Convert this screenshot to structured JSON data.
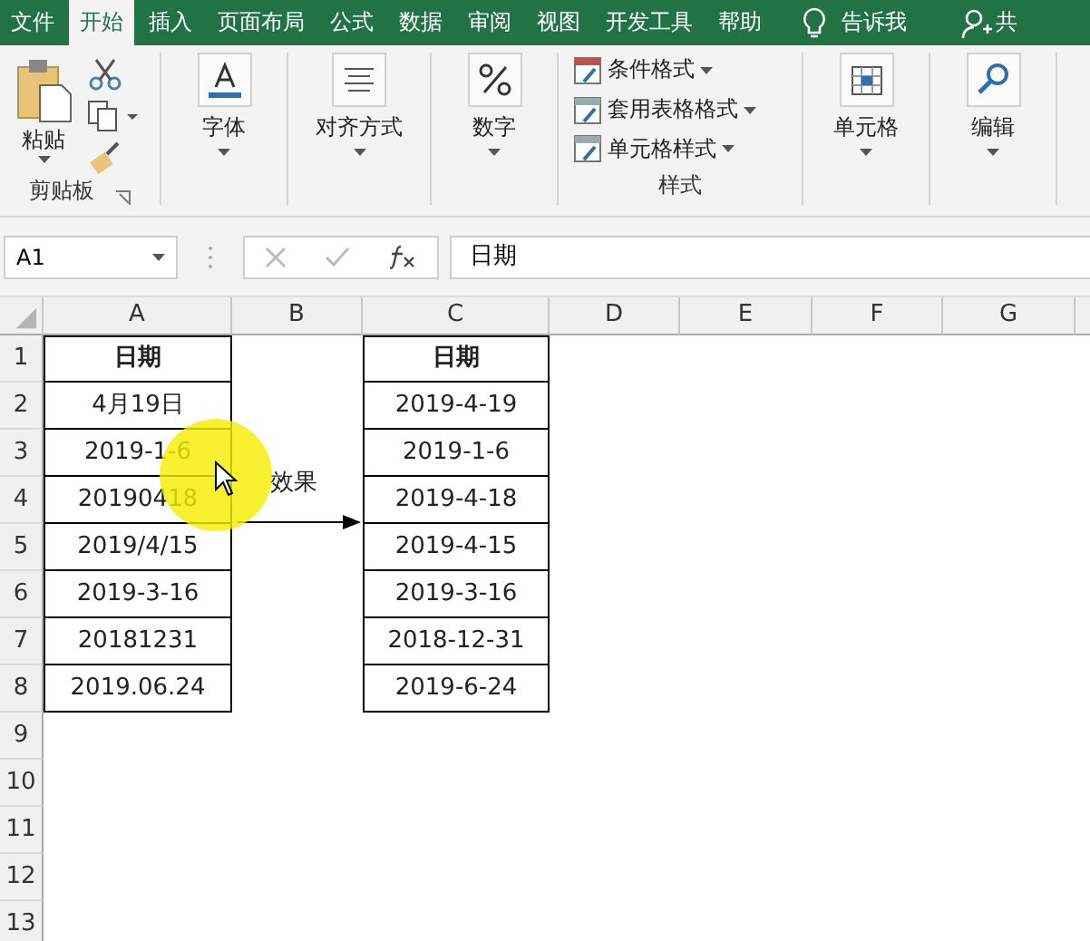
{
  "ribbon_tabs": [
    {
      "label": "文件",
      "selected": false
    },
    {
      "label": "开始",
      "selected": true
    },
    {
      "label": "插入",
      "selected": false
    },
    {
      "label": "页面布局",
      "selected": false
    },
    {
      "label": "公式",
      "selected": false
    },
    {
      "label": "数据",
      "selected": false
    },
    {
      "label": "审阅",
      "selected": false
    },
    {
      "label": "视图",
      "selected": false
    },
    {
      "label": "开发工具",
      "selected": false
    },
    {
      "label": "帮助",
      "selected": false
    }
  ],
  "tell_me": "告诉我",
  "share": "共",
  "ribbon_groups": [
    {
      "kind": "clipboard",
      "paste": "粘贴",
      "label": "剪贴板"
    },
    {
      "kind": "font",
      "label": "字体"
    },
    {
      "kind": "align",
      "label": "对齐方式"
    },
    {
      "kind": "number",
      "label": "数字"
    },
    {
      "kind": "styles",
      "items": [
        "条件格式",
        "套用表格格式",
        "单元格样式"
      ],
      "label": "样式"
    },
    {
      "kind": "cells",
      "label": "单元格"
    },
    {
      "kind": "find",
      "label": "编辑"
    }
  ],
  "name_box": "A1",
  "formula": "日期",
  "columns": [
    "A",
    "B",
    "C",
    "D",
    "E",
    "F",
    "G"
  ],
  "rows": [
    {
      "number": "1",
      "kind": "header",
      "a": "日期",
      "c": "日期"
    },
    {
      "number": "2",
      "kind": "data",
      "a": "4月19日",
      "c": "2019-4-19"
    },
    {
      "number": "3",
      "kind": "data",
      "a": "2019-1-6",
      "c": "2019-1-6"
    },
    {
      "number": "4",
      "kind": "data",
      "a": "20190418",
      "c": "2019-4-18"
    },
    {
      "number": "5",
      "kind": "data",
      "a": "2019/4/15",
      "c": "2019-4-15"
    },
    {
      "number": "6",
      "kind": "data",
      "a": "2019-3-16",
      "c": "2019-3-16"
    },
    {
      "number": "7",
      "kind": "data",
      "a": "20181231",
      "c": "2018-12-31"
    },
    {
      "number": "8",
      "kind": "data",
      "a": "2019.06.24",
      "c": "2019-6-24"
    },
    {
      "number": "9"
    },
    {
      "number": "10"
    },
    {
      "number": "11"
    },
    {
      "number": "12"
    },
    {
      "number": "13"
    }
  ],
  "arrow_label": "效果"
}
